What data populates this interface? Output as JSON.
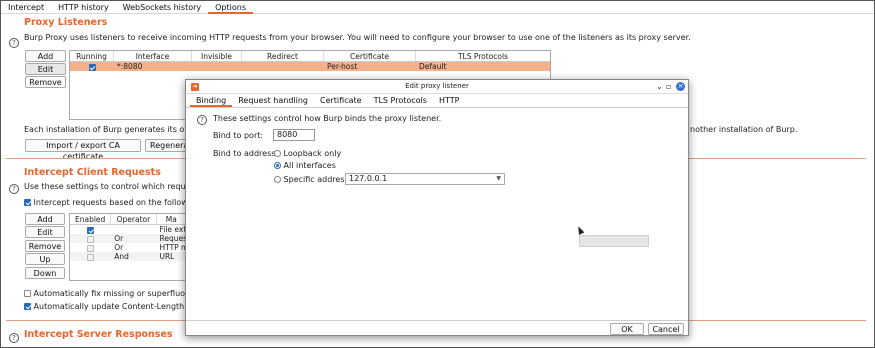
{
  "top_tabs": [
    "Intercept",
    "HTTP history",
    "WebSockets history",
    "Options"
  ],
  "proxy_listeners": {
    "title": "Proxy Listeners",
    "description": "Burp Proxy uses listeners to receive incoming HTTP requests from your browser. You will need to configure your browser to use one of the listeners as its proxy server.",
    "buttons": {
      "add": "Add",
      "edit": "Edit",
      "remove": "Remove"
    },
    "columns": [
      "Running",
      "Interface",
      "Invisible",
      "Redirect",
      "Certificate",
      "TLS Protocols"
    ],
    "rows": [
      {
        "running": true,
        "interface": "*:8080",
        "invisible": "",
        "redirect": "",
        "certificate": "Per-host",
        "tls": "Default"
      }
    ],
    "ca_text_left": "Each installation of Burp generates its own CA",
    "ca_text_right": "nother installation of Burp.",
    "import_export_label": "Import / export CA certificate",
    "regenerate_label": "Regenerat"
  },
  "intercept_client": {
    "title": "Intercept Client Requests",
    "description": "Use these settings to control which requests a",
    "intercept_checkbox_label": "Intercept requests based on the following r",
    "buttons": {
      "add": "Add",
      "edit": "Edit",
      "remove": "Remove",
      "up": "Up",
      "down": "Down"
    },
    "columns": [
      "Enabled",
      "Operator",
      "Ma"
    ],
    "rows": [
      {
        "enabled": true,
        "operator": "",
        "match": "File ext"
      },
      {
        "enabled": false,
        "operator": "Or",
        "match": "Reques"
      },
      {
        "enabled": false,
        "operator": "Or",
        "match": "HTTP m"
      },
      {
        "enabled": false,
        "operator": "And",
        "match": "URL"
      }
    ],
    "fix_newlines_label": "Automatically fix missing or superfluous ne",
    "update_length_label": "Automatically update Content-Length heade"
  },
  "intercept_server": {
    "title": "Intercept Server Responses"
  },
  "dialog": {
    "title": "Edit proxy listener",
    "tabs": [
      "Binding",
      "Request handling",
      "Certificate",
      "TLS Protocols",
      "HTTP"
    ],
    "info_text": "These settings control how Burp binds the proxy listener.",
    "bind_port_label": "Bind to port:",
    "bind_port_value": "8080",
    "bind_address_label": "Bind to address:",
    "loopback_label": "Loopback only",
    "all_interfaces_label": "All interfaces",
    "specific_address_label": "Specific address:",
    "specific_address_value": "127.0.0.1",
    "ok_label": "OK",
    "cancel_label": "Cancel"
  },
  "colors": {
    "accent": "#e8662d",
    "selected_row": "#f4b08a",
    "checkbox_blue": "#2a6ab8"
  }
}
